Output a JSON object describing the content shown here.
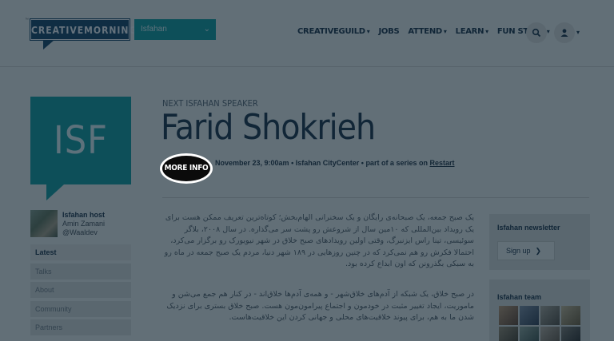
{
  "header": {
    "logo_text": "CREATIVEMORNINGS",
    "logo_mark": "™",
    "city_select": "Isfahan",
    "nav": [
      {
        "label": "CREATIVEGUILD",
        "dropdown": true
      },
      {
        "label": "JOBS",
        "dropdown": false
      },
      {
        "label": "ATTEND",
        "dropdown": true
      },
      {
        "label": "LEARN",
        "dropdown": true
      },
      {
        "label": "FUN STUFF",
        "dropdown": true
      }
    ]
  },
  "sidebar": {
    "city_code": "ISF",
    "host_title": "Isfahan host",
    "host_name": "Amin Zamani",
    "host_handle": "@Waaldev",
    "menu": [
      "Latest",
      "Talks",
      "About",
      "Community",
      "Partners"
    ]
  },
  "main": {
    "kicker": "NEXT ISFAHAN SPEAKER",
    "speaker": "Farid Shokrieh",
    "more_info": "MORE INFO",
    "event_date": "November 23, 9:00am",
    "event_venue": "Isfahan CityCenter",
    "event_series_prefix": "part of a series on",
    "event_series_link": "Restart",
    "paragraph_1": "یک صبح جمعه، یک صبحانه‌ی رایگان و یک سخنرانی الهام‌بخش؛ کوتاه‌ترین تعریف ممکن هست برای یک رویداد بین‌المللی که ۱۰مین سال از شروعش رو پشت سر می‌گذاره. در سال ۲۰۰۸، بلاگر سوئیسی، تینا راس ایزنبرگ، وقتی اولین رویدادهای صبح خلاق در شهر نیویورک رو برگزار می‌کرد، احتمالا فکرش رو هم نمی‌کرد که در چنین روزهایی در ۱۸۹ شهر دنیا، مردم یک صبح جمعه در ماه رو به سبکی بگذرونن که اون ابداع کرده بود.",
    "paragraph_2": "در صبح خلاق، یک شبکه از آدم‌های خلاق‌شهر - و همه‌ی آدم‌ها خلاق‌اند - در کنار هم جمع می‌شن و ماموریت، ایجاد تغییر مثبت در خودمون و اجتماع پیرامون‌مون هست. صبح خلاق بستری برای نزدیک شدن ما به هم، برای پیوند خلاقیت‌های محلی و جهانی کردن این خلاقیت‌هاست."
  },
  "right": {
    "newsletter_title": "Isfahan newsletter",
    "signup_label": "Sign up",
    "team_title": "Isfahan team"
  },
  "colors": {
    "brand_teal": "#1aa3a3",
    "brand_navy": "#1f4a6b",
    "overlay": "#061c2c"
  }
}
